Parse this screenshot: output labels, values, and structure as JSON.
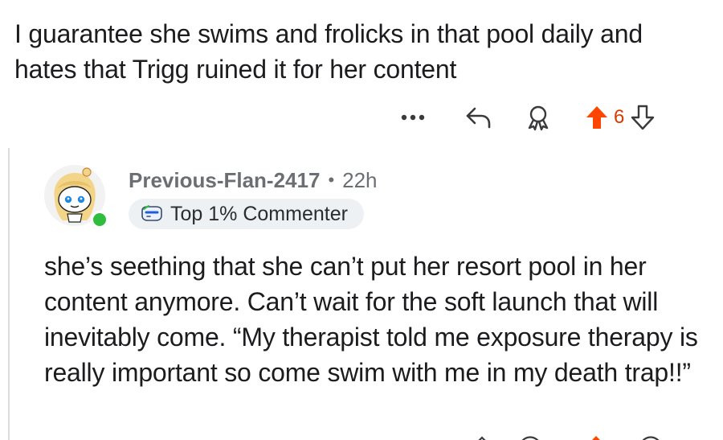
{
  "parent_comment": {
    "text": "I guarantee she swims and frolicks in that pool daily and hates that Trigg ruined it for her content",
    "actions": {
      "more_icon": "more-horizontal-icon",
      "reply_icon": "reply-arrow-icon",
      "award_icon": "award-icon",
      "upvote_icon": "upvote-arrow-icon",
      "downvote_icon": "downvote-arrow-icon",
      "vote_count": "6"
    }
  },
  "reply_comment": {
    "username": "Previous-Flan-2417",
    "separator": "•",
    "age": "22h",
    "flair": "Top 1% Commenter",
    "flair_icon": "commenter-badge-icon",
    "avatar_icon": "snoo-avatar-icon",
    "online": true,
    "text": "she’s seething that she can’t put her resort pool in her content anymore. Can’t wait for the soft launch that will inevitably come. “My therapist told me exposure therapy is really important so come swim with me in my death trap!!”"
  },
  "colors": {
    "upvote_active": "#ff4500",
    "vote_count": "#d93a00",
    "meta_text": "#6b6f73",
    "online": "#2fbd3f",
    "flair_bg": "#eef1f3",
    "thread_line": "#dcdcdc"
  }
}
